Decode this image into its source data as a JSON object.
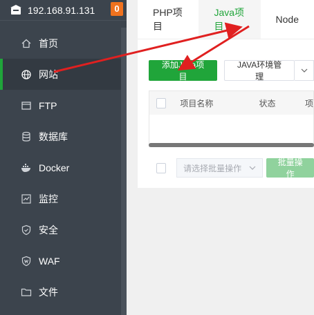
{
  "sidebar": {
    "ip": "192.168.91.131",
    "badge": "0",
    "items": [
      {
        "label": "首页",
        "icon": "home-icon"
      },
      {
        "label": "网站",
        "icon": "globe-icon",
        "active": true
      },
      {
        "label": "FTP",
        "icon": "ftp-icon"
      },
      {
        "label": "数据库",
        "icon": "database-icon"
      },
      {
        "label": "Docker",
        "icon": "docker-icon"
      },
      {
        "label": "监控",
        "icon": "monitor-icon"
      },
      {
        "label": "安全",
        "icon": "shield-icon"
      },
      {
        "label": "WAF",
        "icon": "waf-shield-icon"
      },
      {
        "label": "文件",
        "icon": "folder-icon"
      }
    ]
  },
  "tabs": [
    {
      "label": "PHP项目"
    },
    {
      "label": "Java项目",
      "active": true
    },
    {
      "label": "Node"
    }
  ],
  "toolbar": {
    "add_label": "添加Java项目",
    "env_label": "JAVA环境管理"
  },
  "table": {
    "columns": [
      "项目名称",
      "状态",
      "项"
    ]
  },
  "footer": {
    "select_placeholder": "请选择批量操作",
    "batch_label": "批量操作"
  },
  "colors": {
    "accent": "#20a53a",
    "sidebar_bg": "#3c444d",
    "badge": "#f0721e",
    "annotation_arrow": "#e02020"
  }
}
